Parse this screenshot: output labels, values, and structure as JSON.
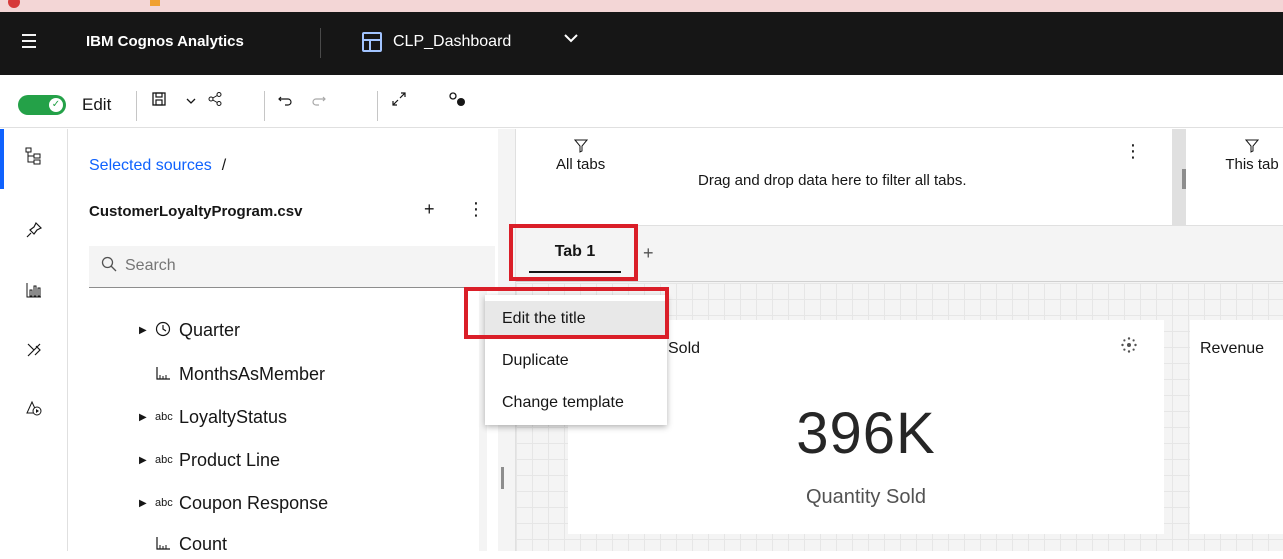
{
  "header": {
    "app_name": "IBM Cognos Analytics",
    "dashboard_name": "CLP_Dashboard"
  },
  "toolbar": {
    "edit_label": "Edit",
    "edit_mode_on": true
  },
  "sources": {
    "breadcrumb_link": "Selected sources",
    "breadcrumb_sep": "/",
    "file_name": "CustomerLoyaltyProgram.csv",
    "search_placeholder": "Search",
    "items": [
      {
        "label": "Quarter",
        "icon": "clock-icon",
        "expandable": true
      },
      {
        "label": "MonthsAsMember",
        "icon": "measure-icon",
        "expandable": false
      },
      {
        "label": "LoyaltyStatus",
        "icon": "abc-icon",
        "expandable": true
      },
      {
        "label": "Product Line",
        "icon": "abc-icon",
        "expandable": true
      },
      {
        "label": "Coupon Response",
        "icon": "abc-icon",
        "expandable": true
      },
      {
        "label": "Count",
        "icon": "measure-icon",
        "expandable": false
      }
    ]
  },
  "filters": {
    "all_tabs_label": "All tabs",
    "hint": "Drag and drop data here to filter all tabs.",
    "this_tab_label": "This tab"
  },
  "tabs": [
    {
      "label": "Tab 1",
      "active": true
    }
  ],
  "context_menu": {
    "items": [
      {
        "label": "Edit the title",
        "highlighted": true
      },
      {
        "label": "Duplicate"
      },
      {
        "label": "Change template"
      }
    ]
  },
  "cards": {
    "kpi_title": "Sold",
    "kpi_value": "396K",
    "kpi_caption": "Quantity Sold",
    "second_title": "Revenue"
  },
  "colors": {
    "header_bg": "#161616",
    "toggle_on": "#24a148",
    "link": "#0f62fe",
    "annotation_red": "#da1e28"
  }
}
